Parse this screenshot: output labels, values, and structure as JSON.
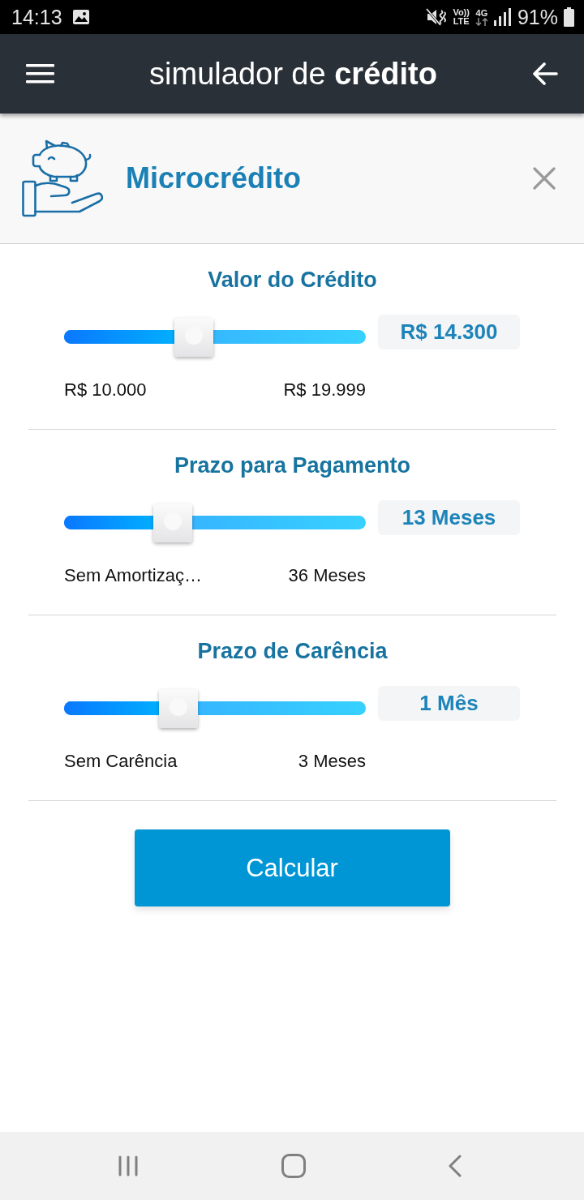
{
  "status_bar": {
    "time": "14:13",
    "volte": [
      "Vo))",
      "LTE"
    ],
    "network": "4G",
    "battery": "91%"
  },
  "app_bar": {
    "title": "simulador de **crédito**"
  },
  "product": {
    "title": "Microcrédito"
  },
  "sliders": [
    {
      "title": "Valor do Crédito",
      "level": 0.43,
      "value": "R$ 14.300",
      "min_label": "R$ 10.000",
      "max_label": "R$ 19.999"
    },
    {
      "title": "Prazo para Pagamento",
      "level": 0.36,
      "value": "13 Meses",
      "min_label": "Sem Amortizaç…",
      "max_label": "36 Meses"
    },
    {
      "title": "Prazo de Carência",
      "level": 0.38,
      "value": "1 Mês",
      "min_label": "Sem Carência",
      "max_label": "3 Meses"
    }
  ],
  "button": {
    "label": "Calcular"
  }
}
